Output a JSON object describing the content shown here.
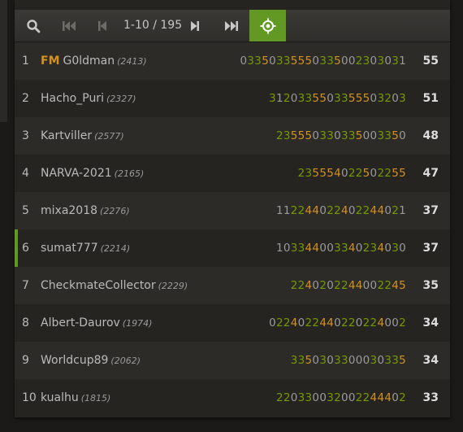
{
  "toolbar": {
    "search_icon": "search-icon",
    "first_icon": "first-page-icon",
    "prev_icon": "previous-page-icon",
    "pager_text": "1-10 / 195",
    "next_icon": "next-page-icon",
    "last_icon": "last-page-icon",
    "locate_icon": "crosshair-icon",
    "active_color": "#629924"
  },
  "colors": {
    "win": "#759900",
    "streak": "#d59120",
    "loss": "#9a9a9a",
    "highlight": "#629924"
  },
  "rows": [
    {
      "rank": "1",
      "title": "FM",
      "name": "G0ldman",
      "rating": "(2413)",
      "sheet": "03350335550335002303031",
      "score": "55",
      "me": false
    },
    {
      "rank": "2",
      "title": "",
      "name": "Hacho_Puri",
      "rating": "(2327)",
      "sheet": "3120335503355503203",
      "score": "51",
      "me": false
    },
    {
      "rank": "3",
      "title": "",
      "name": "Kartviller",
      "rating": "(2577)",
      "sheet": "23555033033500335 0",
      "score": "48",
      "me": false
    },
    {
      "rank": "4",
      "title": "",
      "name": "NARVA-2021",
      "rating": "(2165)",
      "sheet": "2355540225 02255",
      "score": "47",
      "me": false
    },
    {
      "rank": "5",
      "title": "",
      "name": "mixa2018",
      "rating": "(2276)",
      "sheet": "11224402240224402 1",
      "score": "37",
      "me": false
    },
    {
      "rank": "6",
      "title": "",
      "name": "sumat777",
      "rating": "(2214)",
      "sheet": "1033440033402340 30",
      "score": "37",
      "me": true
    },
    {
      "rank": "7",
      "title": "",
      "name": "CheckmateCollector",
      "rating": "(2229)",
      "sheet": "2240202244002245",
      "score": "35",
      "me": false
    },
    {
      "rank": "8",
      "title": "",
      "name": "Albert-Daurov",
      "rating": "(1974)",
      "sheet": "0224022440220224002",
      "score": "34",
      "me": false
    },
    {
      "rank": "9",
      "title": "",
      "name": "Worldcup89",
      "rating": "(2062)",
      "sheet": "335030330003033 5",
      "score": "34",
      "me": false
    },
    {
      "rank": "10",
      "title": "",
      "name": "kualhu",
      "rating": "(1815)",
      "sheet": "220330032002244402",
      "score": "33",
      "me": false
    }
  ]
}
